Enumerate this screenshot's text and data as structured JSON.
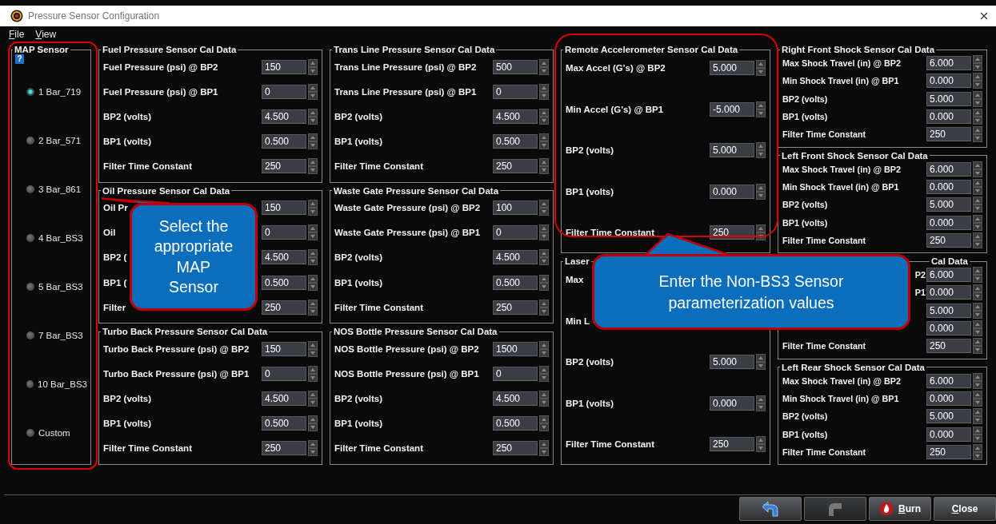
{
  "window": {
    "title": "Pressure Sensor Configuration"
  },
  "menu": [
    "File",
    "View"
  ],
  "map_sensor": {
    "title": "MAP Sensor",
    "help": "?",
    "options": [
      {
        "label": "1 Bar_719",
        "selected": true
      },
      {
        "label": "2 Bar_571",
        "selected": false
      },
      {
        "label": "3 Bar_861",
        "selected": false
      },
      {
        "label": "4 Bar_BS3",
        "selected": false
      },
      {
        "label": "5 Bar_BS3",
        "selected": false
      },
      {
        "label": "7 Bar_BS3",
        "selected": false
      },
      {
        "label": "10 Bar_BS3",
        "selected": false
      },
      {
        "label": "Custom",
        "selected": false
      }
    ]
  },
  "columns": [
    [
      {
        "title": "Fuel Pressure Sensor Cal Data",
        "rows": [
          {
            "label": "Fuel Pressure (psi) @ BP2",
            "value": "150"
          },
          {
            "label": "Fuel Pressure (psi) @ BP1",
            "value": "0"
          },
          {
            "label": "BP2 (volts)",
            "value": "4.500"
          },
          {
            "label": "BP1 (volts)",
            "value": "0.500"
          },
          {
            "label": "Filter Time Constant",
            "value": "250"
          }
        ]
      },
      {
        "title": "Oil Pressure Sensor Cal Data",
        "rows": [
          {
            "label": "Oil Pr",
            "value": "150"
          },
          {
            "label": "Oil",
            "value": "0"
          },
          {
            "label": "BP2 (",
            "value": "4.500"
          },
          {
            "label": "BP1 (",
            "value": "0.500"
          },
          {
            "label": "Filter",
            "value": "250"
          }
        ]
      },
      {
        "title": "Turbo Back Pressure Sensor Cal Data",
        "rows": [
          {
            "label": "Turbo Back Pressure (psi) @ BP2",
            "value": "150"
          },
          {
            "label": "Turbo Back Pressure (psi) @ BP1",
            "value": "0"
          },
          {
            "label": "BP2 (volts)",
            "value": "4.500"
          },
          {
            "label": "BP1 (volts)",
            "value": "0.500"
          },
          {
            "label": "Filter Time Constant",
            "value": "250"
          }
        ]
      }
    ],
    [
      {
        "title": "Trans Line Pressure Sensor Cal Data",
        "rows": [
          {
            "label": "Trans Line Pressure (psi) @ BP2",
            "value": "500"
          },
          {
            "label": "Trans Line Pressure (psi) @ BP1",
            "value": "0"
          },
          {
            "label": "BP2 (volts)",
            "value": "4.500"
          },
          {
            "label": "BP1 (volts)",
            "value": "0.500"
          },
          {
            "label": "Filter Time Constant",
            "value": "250"
          }
        ]
      },
      {
        "title": "Waste Gate Pressure Sensor Cal Data",
        "rows": [
          {
            "label": "Waste Gate Pressure (psi) @ BP2",
            "value": "100"
          },
          {
            "label": "Waste Gate Pressure (psi) @ BP1",
            "value": "0"
          },
          {
            "label": "BP2 (volts)",
            "value": "4.500"
          },
          {
            "label": "BP1 (volts)",
            "value": "0.500"
          },
          {
            "label": "Filter Time Constant",
            "value": "250"
          }
        ]
      },
      {
        "title": "NOS Bottle Pressure Sensor Cal Data",
        "rows": [
          {
            "label": "NOS Bottle Pressure (psi) @ BP2",
            "value": "1500"
          },
          {
            "label": "NOS Bottle Pressure (psi) @ BP1",
            "value": "0"
          },
          {
            "label": "BP2 (volts)",
            "value": "4.500"
          },
          {
            "label": "BP1 (volts)",
            "value": "0.500"
          },
          {
            "label": "Filter Time Constant",
            "value": "250"
          }
        ]
      }
    ],
    [
      {
        "title": "Remote Accelerometer Sensor Cal Data",
        "rows": [
          {
            "label": "Max Accel (G's) @ BP2",
            "value": "5.000"
          },
          {
            "label": "Min Accel (G's) @ BP1",
            "value": "-5.000"
          },
          {
            "label": "BP2 (volts)",
            "value": "5.000"
          },
          {
            "label": "BP1 (volts)",
            "value": "0.000"
          },
          {
            "label": "Filter Time Constant",
            "value": "250"
          }
        ]
      },
      {
        "title": "Laser",
        "rows": [
          {
            "label": "Max"
          },
          {
            "label": "Min L"
          },
          {
            "label": "BP2 (volts)",
            "value": "5.000"
          },
          {
            "label": "BP1 (volts)",
            "value": "0.000"
          },
          {
            "label": "Filter Time Constant",
            "value": "250"
          }
        ]
      }
    ],
    [
      {
        "title": "Right Front Shock Sensor Cal Data",
        "rows": [
          {
            "label": "Max Shock Travel (in) @ BP2",
            "value": "6.000"
          },
          {
            "label": "Min Shock Travel (in) @ BP1",
            "value": "0.000"
          },
          {
            "label": "BP2 (volts)",
            "value": "5.000"
          },
          {
            "label": "BP1 (volts)",
            "value": "0.000"
          },
          {
            "label": "Filter Time Constant",
            "value": "250"
          }
        ]
      },
      {
        "title": "Left Front Shock Sensor Cal Data",
        "rows": [
          {
            "label": "Max Shock Travel (in) @ BP2",
            "value": "6.000"
          },
          {
            "label": "Min Shock Travel (in) @ BP1",
            "value": "0.000"
          },
          {
            "label": "BP2 (volts)",
            "value": "5.000"
          },
          {
            "label": "BP1 (volts)",
            "value": "0.000"
          },
          {
            "label": "Filter Time Constant",
            "value": "250"
          }
        ]
      },
      {
        "title": "Cal Data",
        "tail": true,
        "rows": [
          {
            "label": "P2",
            "tail": true,
            "value": "6.000"
          },
          {
            "label": "P1",
            "tail": true,
            "value": "0.000"
          },
          {
            "value": "5.000"
          },
          {
            "value": "0.000"
          },
          {
            "label": "Filter Time Constant",
            "value": "250"
          }
        ]
      },
      {
        "title": "Left Rear Shock Sensor Cal Data",
        "rows": [
          {
            "label": "Max Shock Travel (in) @ BP2",
            "value": "6.000"
          },
          {
            "label": "Min Shock Travel (in) @ BP1",
            "value": "0.000"
          },
          {
            "label": "BP2 (volts)",
            "value": "5.000"
          },
          {
            "label": "BP1 (volts)",
            "value": "0.000"
          },
          {
            "label": "Filter Time Constant",
            "value": "250"
          }
        ]
      }
    ]
  ],
  "buttons": [
    {
      "kind": "undo",
      "disabled": false
    },
    {
      "kind": "redo",
      "disabled": true
    },
    {
      "kind": "burn",
      "label": "Burn",
      "disabled": false
    },
    {
      "kind": "close",
      "label": "Close",
      "disabled": false
    }
  ],
  "callouts": [
    {
      "text": "Select the\nappropriate\nMAP\nSensor"
    },
    {
      "text": "Enter the Non-BS3 Sensor\nparameterization values"
    }
  ]
}
